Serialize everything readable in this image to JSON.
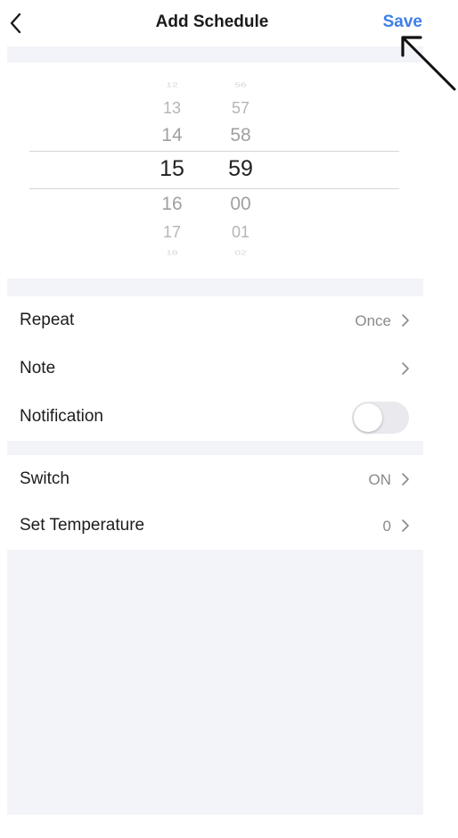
{
  "header": {
    "title": "Add Schedule",
    "save_label": "Save",
    "back_icon": "chevron-left-icon"
  },
  "picker": {
    "hours": [
      "12",
      "13",
      "14",
      "15",
      "16",
      "17",
      "18"
    ],
    "minutes": [
      "56",
      "57",
      "58",
      "59",
      "00",
      "01",
      "02"
    ],
    "selected_hour": "15",
    "selected_minute": "59"
  },
  "settings": {
    "repeat": {
      "label": "Repeat",
      "value": "Once"
    },
    "note": {
      "label": "Note",
      "value": ""
    },
    "notification": {
      "label": "Notification",
      "enabled": false
    }
  },
  "actions": {
    "switch": {
      "label": "Switch",
      "value": "ON"
    },
    "set_temperature": {
      "label": "Set Temperature",
      "value": "0"
    }
  },
  "colors": {
    "accent": "#3f7ee8",
    "section_bg": "#f3f4f9",
    "toggle_off": "#e9e9ee"
  }
}
